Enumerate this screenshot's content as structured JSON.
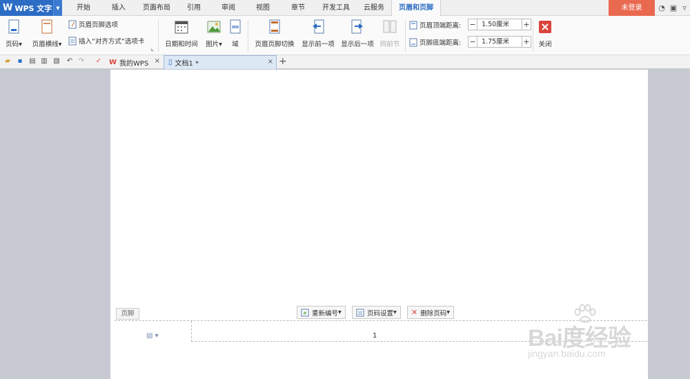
{
  "app": {
    "logo": "W",
    "name": "WPS 文字",
    "dropdown_glyph": "▼"
  },
  "menu_tabs": [
    "开始",
    "插入",
    "页面布局",
    "引用",
    "审阅",
    "视图",
    "章节",
    "开发工具",
    "云服务",
    "页眉和页脚"
  ],
  "login_label": "未登录",
  "ribbon": {
    "page_number": "页码",
    "header_line": "页眉横线",
    "hf_options": "页眉页脚选项",
    "insert_align_tab": "插入“对齐方式”选项卡",
    "date_time": "日期和时间",
    "picture": "图片",
    "field": "域",
    "hf_switch": "页眉页脚切换",
    "show_prev": "显示前一项",
    "show_next": "显示后一项",
    "same_as_prev": "同前节",
    "header_top_label": "页眉顶端距离:",
    "header_top_value": "1.50厘米",
    "footer_bottom_label": "页脚底端距离:",
    "footer_bottom_value": "1.75厘米",
    "close": "关闭",
    "minus": "−",
    "plus": "+",
    "dropdown_glyph": "▾"
  },
  "doc_tabs": [
    {
      "title": "我的WPS",
      "close": "×"
    },
    {
      "title": "文档1 *",
      "close": "×"
    }
  ],
  "new_tab": "+",
  "footer": {
    "tag": "页脚",
    "renumber": "重新编号",
    "page_setup": "页码设置",
    "delete_page_number": "删除页码",
    "dropdown_glyph": "▾",
    "page_number": "1"
  },
  "watermark": {
    "main": "Bai度经验",
    "sub": "jingyan.baidu.com"
  },
  "colors": {
    "accent": "#2b6cc4",
    "login": "#e9694f",
    "close": "#d9433b"
  }
}
